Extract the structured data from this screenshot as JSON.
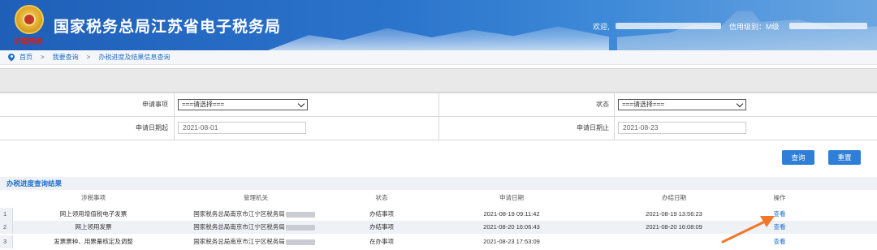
{
  "header": {
    "emblem_text": "中国税务",
    "title": "国家税务总局江苏省电子税务局",
    "welcome": "欢迎,",
    "credit_level": "信用级别：M级"
  },
  "breadcrumb": [
    "首页",
    "我要查询",
    "办税进度及结果信息查询"
  ],
  "breadcrumb_sep": ">",
  "form": {
    "matter_label": "申请事项",
    "matter_value": "===请选择===",
    "status_label": "状态",
    "status_value": "===请选择===",
    "start_label": "申请日期起",
    "start_value": "2021-08-01",
    "end_label": "申请日期止",
    "end_value": "2021-08-23"
  },
  "buttons": {
    "query": "查询",
    "reset": "重置"
  },
  "results": {
    "title": "办税进度查询结果",
    "columns": [
      "涉税事项",
      "管理机关",
      "状态",
      "申请日期",
      "办结日期",
      "操作"
    ],
    "rows": [
      {
        "idx": "1",
        "matter": "网上领用增值税电子发票",
        "org": "国家税务总局南京市江宁区税务局",
        "status": "办结事项",
        "apply": "2021-08-19 09:11:42",
        "done": "2021-08-19 13:56:23",
        "op": "查看"
      },
      {
        "idx": "2",
        "matter": "网上领用发票",
        "org": "国家税务总局南京市江宁区税务局",
        "status": "办结事项",
        "apply": "2021-08-20 16:06:43",
        "done": "2021-08-20 16:08:09",
        "op": "查看"
      },
      {
        "idx": "3",
        "matter": "发票票种、用票量核定及调整",
        "org": "国家税务总局南京市江宁区税务局",
        "status": "在办事项",
        "apply": "2021-08-23 17:53:09",
        "done": "",
        "op": "查看"
      }
    ]
  },
  "colors": {
    "accent": "#1f6fc9",
    "button": "#2f7fd8",
    "annotation_arrow": "#f0782a"
  }
}
